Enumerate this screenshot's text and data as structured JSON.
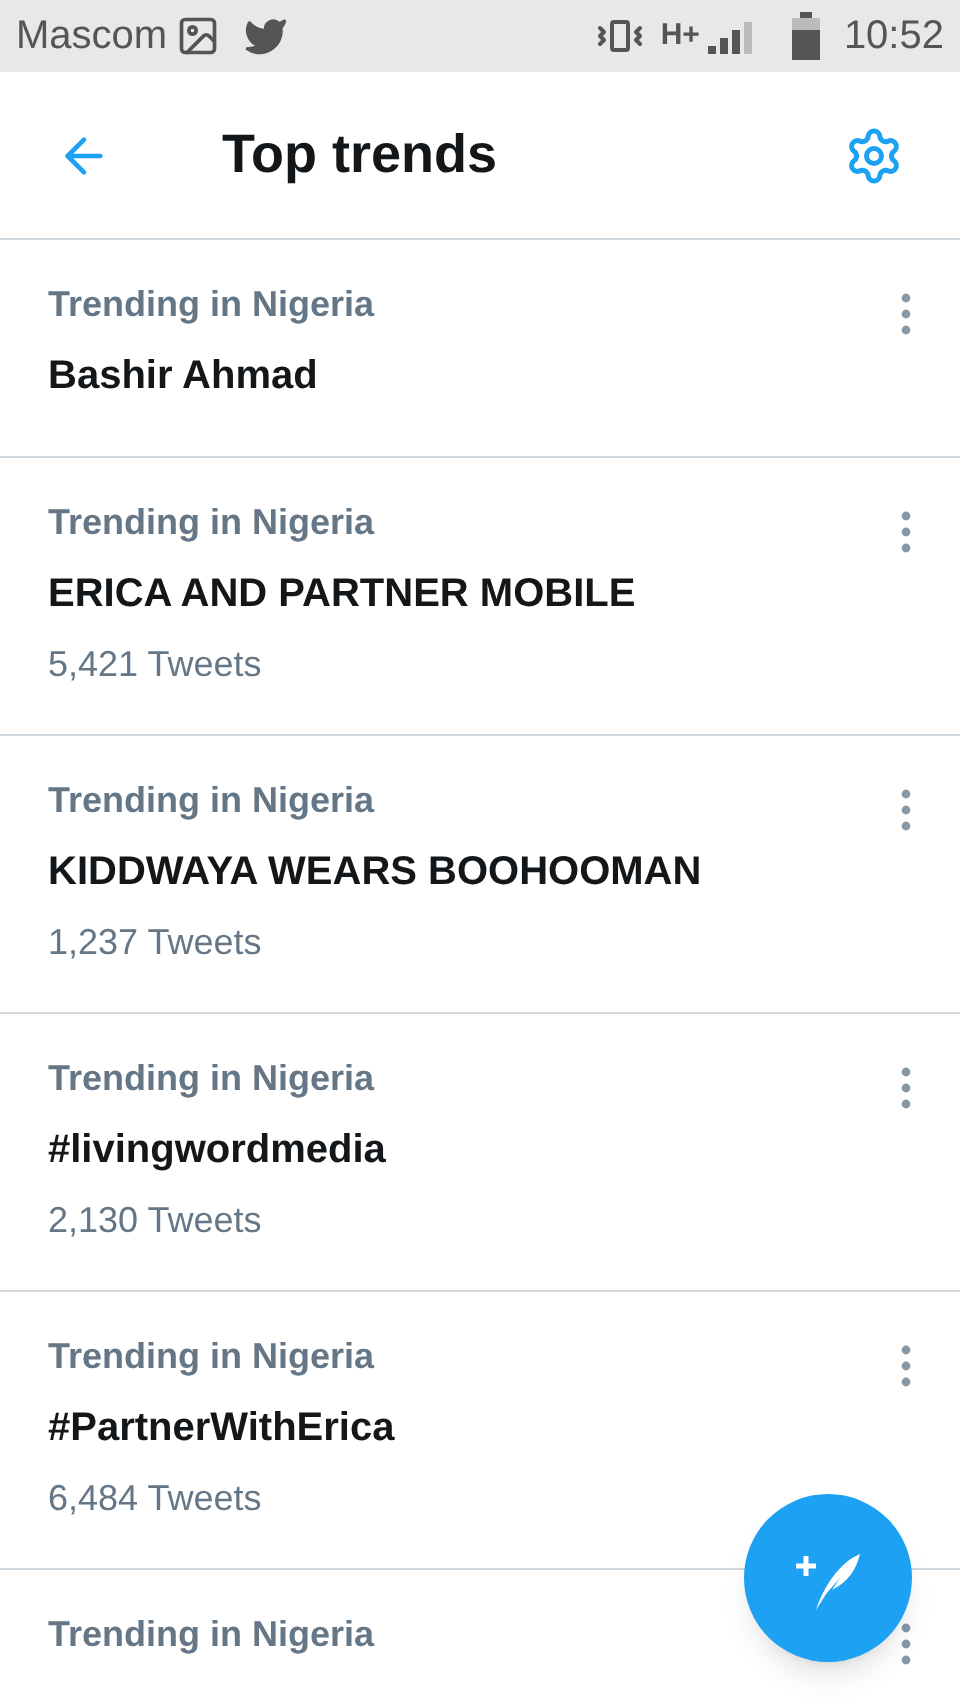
{
  "status_bar": {
    "carrier": "Mascom",
    "network": "H+",
    "time": "10:52"
  },
  "header": {
    "title": "Top trends"
  },
  "trends": [
    {
      "context": "Trending in Nigeria",
      "name": "Bashir Ahmad"
    },
    {
      "context": "Trending in Nigeria",
      "name": "ERICA AND PARTNER MOBILE",
      "count": "5,421 Tweets"
    },
    {
      "context": "Trending in Nigeria",
      "name": "KIDDWAYA WEARS BOOHOOMAN",
      "count": "1,237 Tweets"
    },
    {
      "context": "Trending in Nigeria",
      "name": "#livingwordmedia",
      "count": "2,130 Tweets"
    },
    {
      "context": "Trending in Nigeria",
      "name": "#PartnerWithErica",
      "count": "6,484 Tweets"
    },
    {
      "context": "Trending in Nigeria"
    }
  ]
}
